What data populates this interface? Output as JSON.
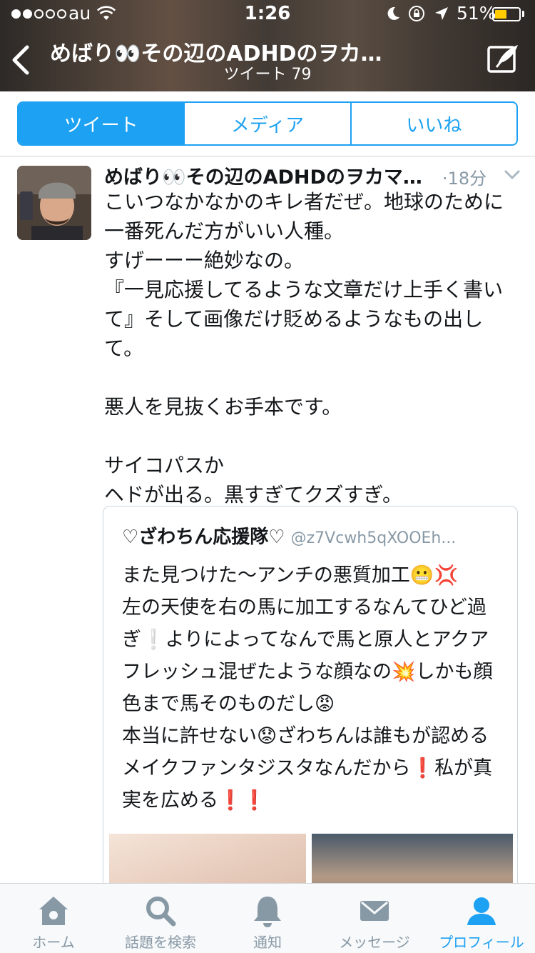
{
  "status_bar": {
    "carrier": "au",
    "time": "1:26",
    "battery_percent": "51%",
    "battery_level": 0.51,
    "signal_bars_filled": 2,
    "signal_bars_total": 5
  },
  "nav": {
    "title": "めばり👀その辺のADHDのヲカ…",
    "subtitle": "ツイート 79",
    "back_icon": "chevron-left-icon",
    "compose_icon": "compose-tweet-icon"
  },
  "segments": [
    {
      "label": "ツイート",
      "active": true
    },
    {
      "label": "メディア",
      "active": false
    },
    {
      "label": "いいね",
      "active": false
    }
  ],
  "tweet": {
    "author": "めばり👀その辺のADHDのヲカマ…",
    "time": "·18分",
    "text": "こいつなかなかのキレ者だぜ。地球のために一番死んだ方がいい人種。\nすげーーー絶妙なの。\n『一見応援してるような文章だけ上手く書いて』そして画像だけ貶めるようなもの出して。\n\n悪人を見抜くお手本です。\n\nサイコパスか\nヘドが出る。黒すぎてクズすぎ。"
  },
  "quote": {
    "name": "♡ざわちん応援隊♡",
    "handle": "@z7Vcwh5qXOOEh...",
    "text": "また見つけた〜アンチの悪質加工😬💢\n左の天使を右の馬に加工するなんてひど過ぎ❕よりによってなんで馬と原人とアクアフレッシュ混ぜたような顔なの💥しかも顔色まで馬そのものだし😡\n本当に許せない😟ざわちんは誰もが認めるメイクファンタジスタなんだから❗️私が真実を広める❗️❗️"
  },
  "tabbar": [
    {
      "label": "ホーム",
      "icon": "home-icon",
      "active": false
    },
    {
      "label": "話題を検索",
      "icon": "search-icon",
      "active": false
    },
    {
      "label": "通知",
      "icon": "bell-icon",
      "active": false
    },
    {
      "label": "メッセージ",
      "icon": "mail-icon",
      "active": false
    },
    {
      "label": "プロフィール",
      "icon": "profile-icon",
      "active": true
    }
  ],
  "colors": {
    "accent": "#1da1f2",
    "muted": "#8899a6",
    "text": "#14171a",
    "battery": "#ffcc00"
  }
}
